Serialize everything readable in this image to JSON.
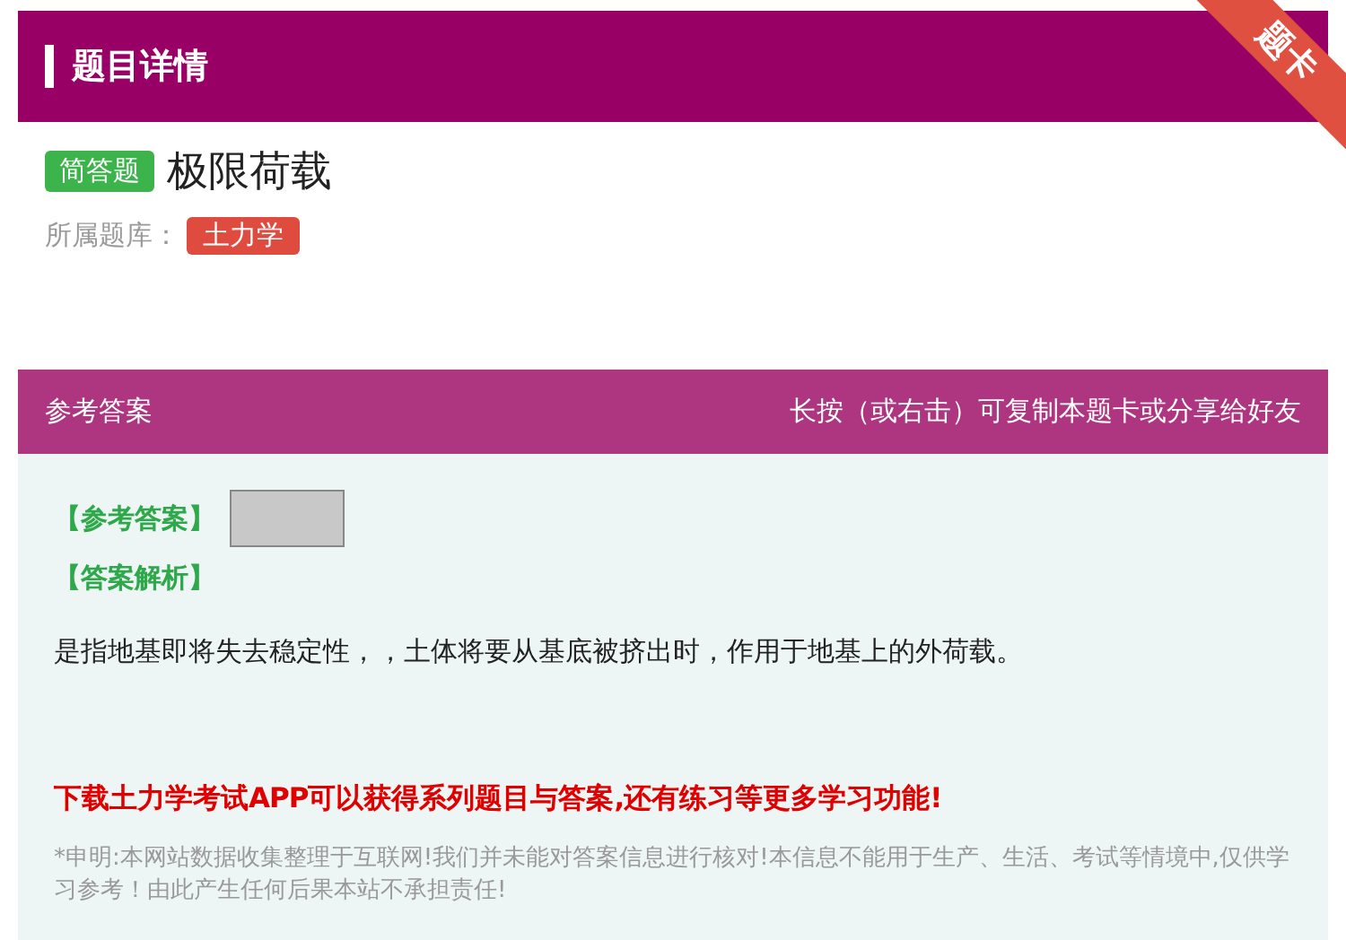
{
  "question_card": {
    "title": "题目详情",
    "corner_badge": "题卡",
    "type_tag": "简答题",
    "question": "极限荷载",
    "bank_label": "所属题库：",
    "bank_tag": "土力学"
  },
  "answer_card": {
    "title": "参考答案",
    "hint": "长按（或右击）可复制本题卡或分享给好友",
    "answer_label": "【参考答案】",
    "analysis_label": "【答案解析】",
    "analysis": "是指地基即将失去稳定性，，土体将要从基底被挤出时，作用于地基上的外荷载。",
    "promo": "下载土力学考试APP可以获得系列题目与答案,还有练习等更多学习功能!",
    "disclaimer": "*申明:本网站数据收集整理于互联网!我们并未能对答案信息进行核对!本信息不能用于生产、生活、考试等情境中,仅供学习参考！由此产生任何后果本站不承担责任!"
  }
}
